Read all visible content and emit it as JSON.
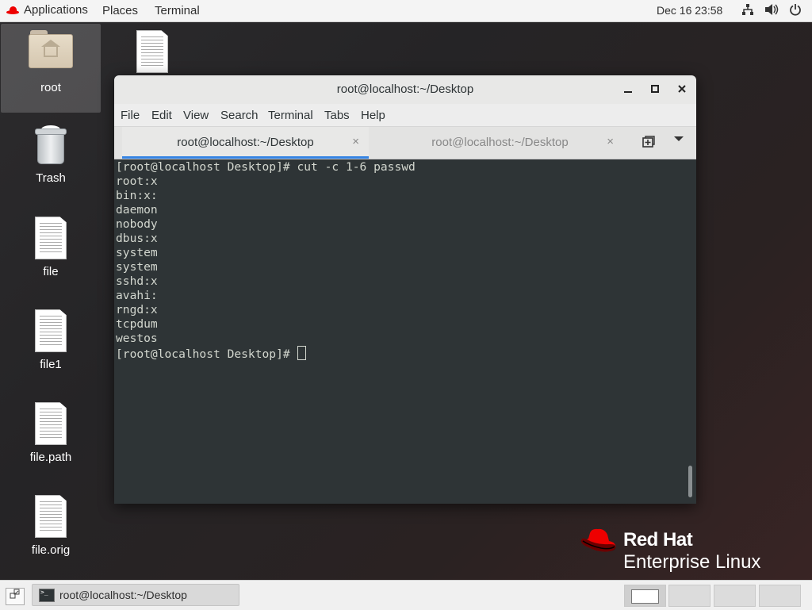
{
  "topbar": {
    "applications": "Applications",
    "places": "Places",
    "terminal": "Terminal",
    "clock": "Dec 16  23:58",
    "tray_icons": [
      "network-icon",
      "volume-icon",
      "power-icon"
    ]
  },
  "desktop": {
    "icons": [
      {
        "label": "root",
        "icon": "home-folder-icon"
      },
      {
        "label": "Trash",
        "icon": "trash-icon"
      },
      {
        "label": "file",
        "icon": "document-icon"
      },
      {
        "label": "file1",
        "icon": "document-icon"
      },
      {
        "label": "file.path",
        "icon": "document-icon"
      },
      {
        "label": "file.orig",
        "icon": "document-icon"
      }
    ]
  },
  "window": {
    "title": "root@localhost:~/Desktop",
    "controls": {
      "minimize": "–",
      "maximize": "□",
      "close": "✕"
    },
    "menu": [
      "File",
      "Edit",
      "View",
      "Search",
      "Terminal",
      "Tabs",
      "Help"
    ],
    "tabs": [
      {
        "label": "root@localhost:~/Desktop",
        "active": true
      },
      {
        "label": "root@localhost:~/Desktop",
        "active": false
      }
    ],
    "tab_close": "×",
    "terminal_lines": [
      "[root@localhost Desktop]# cut -c 1-6 passwd",
      "root:x",
      "bin:x:",
      "daemon",
      "nobody",
      "dbus:x",
      "system",
      "system",
      "sshd:x",
      "avahi:",
      "rngd:x",
      "tcpdum",
      "westos"
    ],
    "prompt": "[root@localhost Desktop]# "
  },
  "branding": {
    "line1": "Red Hat",
    "line2": "Enterprise Linux",
    "accent_color": "#ee0000"
  },
  "taskbar": {
    "task_label": "root@localhost:~/Desktop",
    "workspaces": 4
  }
}
